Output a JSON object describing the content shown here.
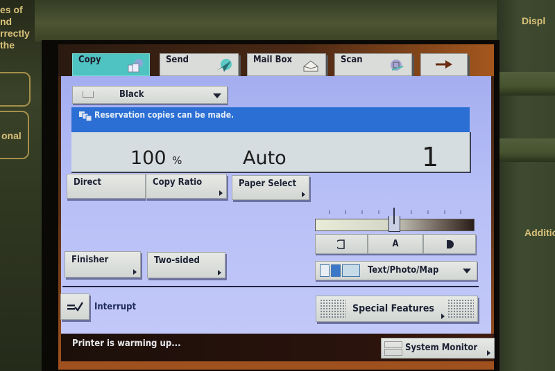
{
  "bezel": {
    "left_text": [
      "es of",
      "nd",
      "rrectly",
      "the"
    ],
    "left_button_2_text": "onal",
    "right_top_text": "Displ",
    "right_mid_text": "Additio"
  },
  "tabs": [
    {
      "label": "Copy",
      "icon": "copy-icon",
      "active": true
    },
    {
      "label": "Send",
      "icon": "paper-plane-icon",
      "active": false
    },
    {
      "label": "Mail Box",
      "icon": "mailbox-tray-icon",
      "active": false
    },
    {
      "label": "Scan",
      "icon": "scan-icon",
      "active": false
    },
    {
      "label": "→",
      "icon": "arrow-right-icon",
      "active": false
    }
  ],
  "color_mode": {
    "value": "Black"
  },
  "message": "Reservation copies can be made.",
  "display": {
    "ratio": "100",
    "ratio_unit": "%",
    "paper": "Auto",
    "copies": "1"
  },
  "buttons": {
    "direct": "Direct",
    "copy_ratio": "Copy Ratio",
    "paper_select": "Paper Select",
    "finisher": "Finisher",
    "two_sided": "Two-sided",
    "interrupt": "Interrupt",
    "special_features": "Special Features",
    "system_monitor": "System Monitor"
  },
  "density": {
    "level": 5,
    "of": 9,
    "lighter_label": "◐",
    "auto_label": "A",
    "darker_label": "◗"
  },
  "original_type": {
    "value": "Text/Photo/Map"
  },
  "status": "Printer is warming up..."
}
